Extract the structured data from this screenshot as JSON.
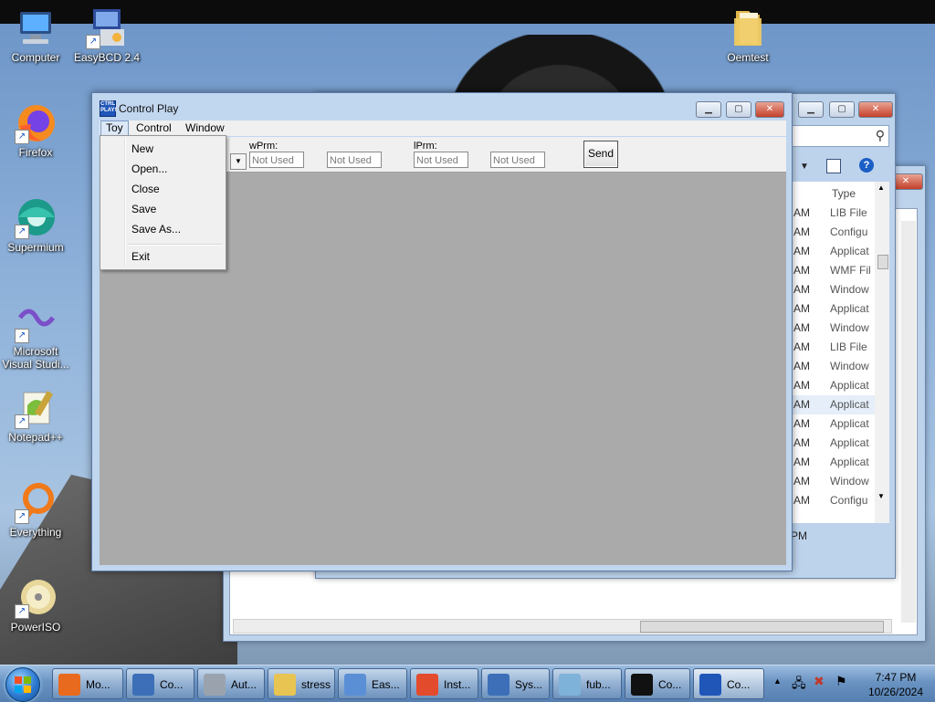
{
  "desktop": {
    "icons": [
      {
        "label": "Computer"
      },
      {
        "label": "EasyBCD 2.4"
      },
      {
        "label": "Oemtest"
      },
      {
        "label": "Firefox"
      },
      {
        "label": "Supermium"
      },
      {
        "label": "Microsoft Visual Studi..."
      },
      {
        "label": "Notepad++"
      },
      {
        "label": "Everything"
      },
      {
        "label": "PowerISO"
      }
    ]
  },
  "explorer": {
    "column_type": "Type",
    "rows": [
      {
        "time": "AM",
        "type": "LIB File"
      },
      {
        "time": "AM",
        "type": "Configu"
      },
      {
        "time": "AM",
        "type": "Applicat"
      },
      {
        "time": "AM",
        "type": "WMF Fil"
      },
      {
        "time": "AM",
        "type": "Window"
      },
      {
        "time": "AM",
        "type": "Applicat"
      },
      {
        "time": "AM",
        "type": "Window"
      },
      {
        "time": "AM",
        "type": "LIB File"
      },
      {
        "time": "AM",
        "type": "Window"
      },
      {
        "time": "AM",
        "type": "Applicat"
      },
      {
        "time": "AM",
        "type": "Applicat"
      },
      {
        "time": "AM",
        "type": "Applicat"
      },
      {
        "time": "AM",
        "type": "Applicat"
      },
      {
        "time": "AM",
        "type": "Applicat"
      },
      {
        "time": "AM",
        "type": "Window"
      },
      {
        "time": "AM",
        "type": "Configu"
      }
    ],
    "status_time": "3 PM"
  },
  "control_play": {
    "title": "Control Play",
    "app_icon_text": "CTRL PLAY!",
    "menus": [
      "Toy",
      "Control",
      "Window"
    ],
    "toolbar": {
      "wparam_label": "wPrm:",
      "lparam_label": "lPrm:",
      "fields": [
        "Not Used",
        "Not Used",
        "Not Used",
        "Not Used"
      ],
      "send_label": "Send"
    },
    "toy_menu": [
      "New",
      "Open...",
      "Close",
      "Save",
      "Save As...",
      "Exit"
    ]
  },
  "taskbar": {
    "items": [
      {
        "label": "Mo...",
        "color": "#e86a1e"
      },
      {
        "label": "Co...",
        "color": "#3c6fb8"
      },
      {
        "label": "Aut...",
        "color": "#9aa3ad"
      },
      {
        "label": "stress",
        "color": "#e8c452"
      },
      {
        "label": "Eas...",
        "color": "#5a8fd6"
      },
      {
        "label": "Inst...",
        "color": "#e34b2d"
      },
      {
        "label": "Sys...",
        "color": "#3c6fb8"
      },
      {
        "label": "fub...",
        "color": "#7fb2d8"
      },
      {
        "label": "Co...",
        "color": "#111111"
      },
      {
        "label": "Co...",
        "color": "#1f56b8"
      }
    ],
    "clock_time": "7:47 PM",
    "clock_date": "10/26/2024"
  }
}
